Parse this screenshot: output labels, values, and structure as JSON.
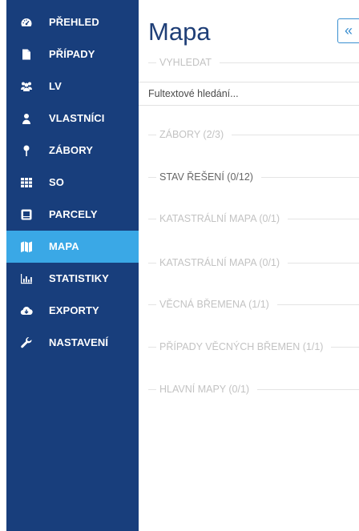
{
  "sidebar": {
    "items": [
      {
        "label": "PŘEHLED",
        "icon": "dashboard-icon"
      },
      {
        "label": "PŘÍPADY",
        "icon": "document-icon"
      },
      {
        "label": "LV",
        "icon": "users-icon"
      },
      {
        "label": "VLASTNÍCI",
        "icon": "user-icon"
      },
      {
        "label": "ZÁBORY",
        "icon": "pin-icon"
      },
      {
        "label": "SO",
        "icon": "grid-icon"
      },
      {
        "label": "PARCELY",
        "icon": "square-icon"
      },
      {
        "label": "MAPA",
        "icon": "map-icon",
        "active": true
      },
      {
        "label": "STATISTIKY",
        "icon": "bar-chart-icon"
      },
      {
        "label": "EXPORTY",
        "icon": "cloud-download-icon"
      },
      {
        "label": "NASTAVENÍ",
        "icon": "wrench-icon"
      }
    ],
    "bg_color": "#183e7c",
    "active_color": "#3aa8e6"
  },
  "main": {
    "title": "Mapa",
    "collapse_label": "«",
    "search": {
      "section_label": "VYHLEDAT",
      "placeholder": "Fultextové hledání..."
    },
    "sections": [
      {
        "label": "ZÁBORY (2/3)",
        "dark": false
      },
      {
        "label": "STAV ŘEŠENÍ (0/12)",
        "dark": true
      },
      {
        "label": "KATASTRÁLNÍ MAPA (0/1)",
        "dark": false
      },
      {
        "label": "KATASTRÁLNÍ MAPA (0/1)",
        "dark": false
      },
      {
        "label": "VĚCNÁ BŘEMENA (1/1)",
        "dark": false
      },
      {
        "label": "PŘÍPADY VĚCNÝCH BŘEMEN (1/1)",
        "dark": false
      },
      {
        "label": "HLAVNÍ MAPY (0/1)",
        "dark": false
      }
    ]
  }
}
